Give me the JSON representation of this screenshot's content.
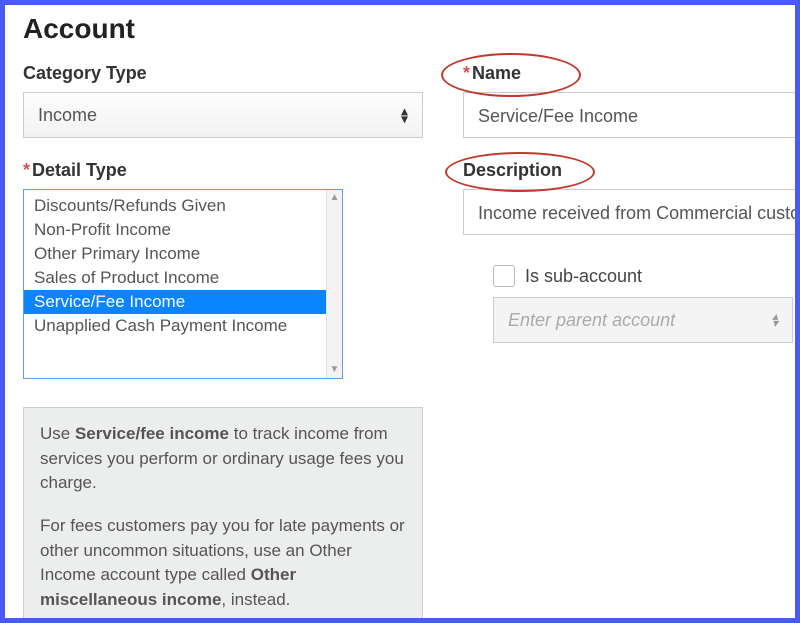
{
  "page_title": "Account",
  "category": {
    "label": "Category Type",
    "value": "Income"
  },
  "detail": {
    "label": "Detail Type",
    "options": [
      "Discounts/Refunds Given",
      "Non-Profit Income",
      "Other Primary Income",
      "Sales of Product Income",
      "Service/Fee Income",
      "Unapplied Cash Payment Income"
    ],
    "selected_index": 4
  },
  "name": {
    "label": "Name",
    "value": "Service/Fee Income"
  },
  "description": {
    "label": "Description",
    "value": "Income received from Commercial custo"
  },
  "sub_account": {
    "label": "Is sub-account",
    "checked": false,
    "parent_placeholder": "Enter parent account"
  },
  "help": {
    "p1_pre": "Use ",
    "p1_bold": "Service/fee income",
    "p1_post": " to track income from services you perform or ordinary usage fees you charge.",
    "p2_pre": "For fees customers pay you for late payments or other uncommon situations, use an Other Income account type called ",
    "p2_bold": "Other miscellaneous income",
    "p2_post": ", instead."
  }
}
